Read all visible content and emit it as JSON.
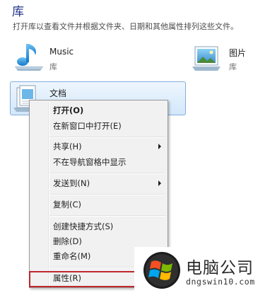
{
  "header": {
    "title": "库",
    "description": "打开库以查看文件并根据文件夹、日期和其他属性排列这些文件。"
  },
  "libraries": [
    {
      "name": "Music",
      "subtitle": "库",
      "icon": "music-library-icon"
    },
    {
      "name": "图片",
      "subtitle": "库",
      "icon": "pictures-library-icon"
    },
    {
      "name": "文档",
      "icon": "documents-library-icon",
      "selected": true
    }
  ],
  "context_menu": {
    "items": {
      "open": "打开(O)",
      "open_new_window": "在新窗口中打开(E)",
      "share": "共享(H)",
      "hide_nav": "不在导航窗格中显示",
      "send_to": "发送到(N)",
      "copy": "复制(C)",
      "create_shortcut": "创建快捷方式(S)",
      "delete": "删除(D)",
      "rename": "重命名(M)",
      "properties": "属性(R)"
    },
    "highlighted_item": "properties",
    "highlight_color": "#c0272d"
  },
  "watermark": {
    "title": "电脑公司",
    "url": "dngswin10.com",
    "logo": "windows-logo"
  }
}
